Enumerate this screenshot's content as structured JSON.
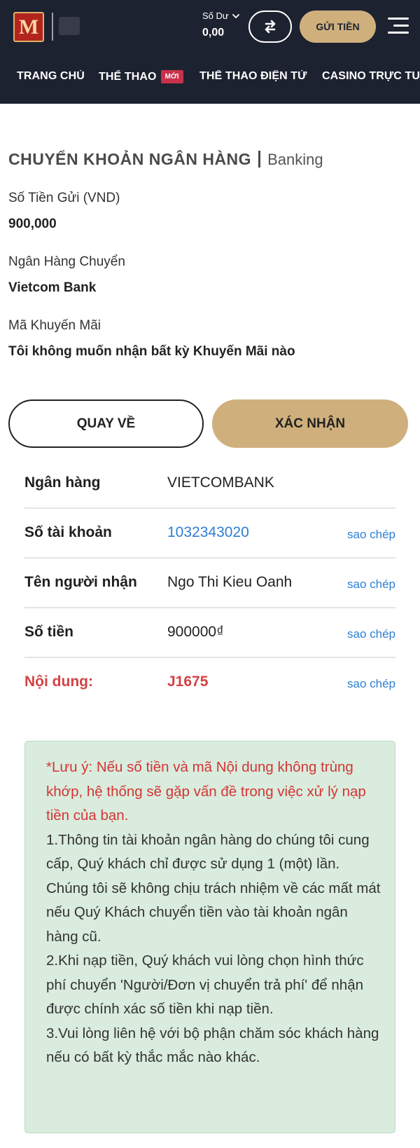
{
  "header": {
    "balance_label": "Số Dư",
    "balance_value": "0,00",
    "deposit_label": "GỬI TIỀN",
    "logo_text": "M"
  },
  "nav": {
    "items": [
      {
        "label": "TRANG CHỦ"
      },
      {
        "label": "THỂ THAO",
        "badge": "MỚI"
      },
      {
        "label": "THỂ THAO ĐIỆN TỬ"
      },
      {
        "label": "CASINO TRỰC TUYẾN"
      }
    ]
  },
  "page": {
    "title": "CHUYỂN KHOẢN NGÂN HÀNG",
    "subtitle": "Banking"
  },
  "form": {
    "amount_label": "Số Tiền Gửi (VND)",
    "amount_value": "900,000",
    "bank_label": "Ngân Hàng Chuyển",
    "bank_value": "Vietcom Bank",
    "promo_label": "Mã Khuyến Mãi",
    "promo_value": "Tôi không muốn nhận bất kỳ Khuyến Mãi nào"
  },
  "actions": {
    "back_label": "QUAY VỀ",
    "confirm_label": "XÁC NHẬN"
  },
  "details": {
    "copy_label": "sao chép",
    "rows": [
      {
        "label": "Ngân hàng",
        "value": "VIETCOMBANK"
      },
      {
        "label": "Số tài khoản",
        "value": "1032343020"
      },
      {
        "label": "Tên người nhận",
        "value": "Ngo Thi Kieu Oanh"
      },
      {
        "label": "Số tiền",
        "value": "900000₫"
      },
      {
        "label": "Nội dung:",
        "value": "J1675"
      }
    ]
  },
  "note": {
    "warning": "*Lưu ý: Nếu số tiền và mã Nội dung không trùng khớp, hệ thống sẽ gặp vấn đề trong việc xử lý nạp tiền của bạn.",
    "item1": "1.Thông tin tài khoản ngân hàng do chúng tôi cung cấp, Quý khách chỉ được sử dụng 1 (một) lần. Chúng tôi sẽ không chịu trách nhiệm về các mất mát nếu Quý Khách chuyển tiền vào tài khoản ngân hàng cũ.",
    "item2": "2.Khi nạp tiền, Quý khách vui lòng chọn hình thức phí chuyển 'Người/Đơn vị chuyển trả phí' để nhận được chính xác số tiền khi nạp tiền.",
    "item3": "3.Vui lòng liên hệ với bộ phận chăm sóc khách hàng nếu có bất kỳ thắc mắc nào khác."
  },
  "colors": {
    "header_bg": "#1d2230",
    "accent_gold": "#cfb07d",
    "link_blue": "#2d7fd4",
    "warning_red": "#d24245",
    "note_bg": "#d9ecdd"
  }
}
